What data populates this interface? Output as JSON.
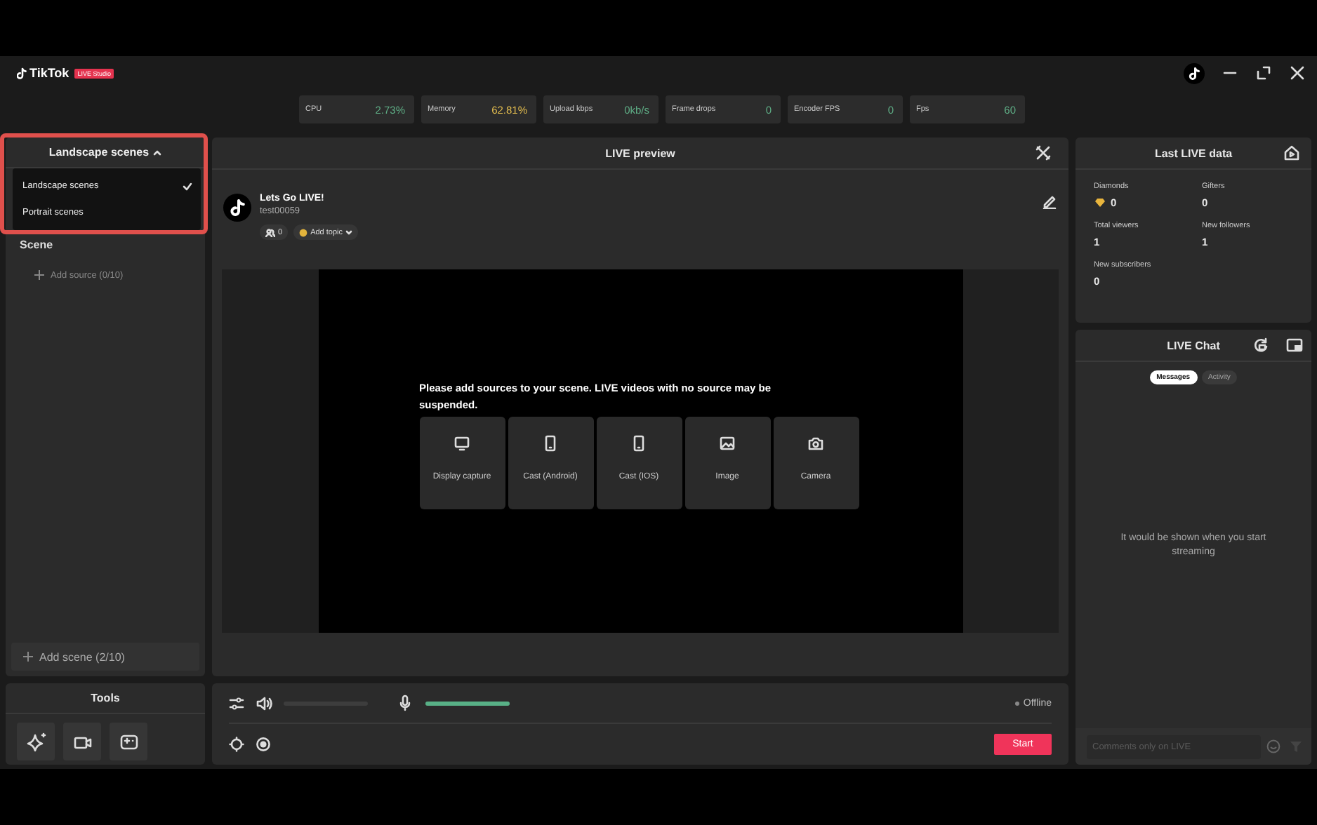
{
  "window": {
    "logo": "TikTok",
    "badge": "LIVE Studio"
  },
  "stats": [
    {
      "label": "CPU",
      "value": "2.73%",
      "color": "#5fae86"
    },
    {
      "label": "Memory",
      "value": "62.81%",
      "color": "#e3bd4f"
    },
    {
      "label": "Upload kbps",
      "value": "0kb/s",
      "color": "#5fae86"
    },
    {
      "label": "Frame drops",
      "value": "0",
      "color": "#5fae86"
    },
    {
      "label": "Encoder FPS",
      "value": "0",
      "color": "#5fae86"
    },
    {
      "label": "Fps",
      "value": "60",
      "color": "#5fae86"
    }
  ],
  "scenes": {
    "title": "Landscape scenes",
    "expanded": true,
    "highlighted": true,
    "options": [
      {
        "label": "Landscape scenes",
        "selected": true
      },
      {
        "label": "Portrait scenes",
        "selected": false
      }
    ],
    "section": "Scene",
    "add_source": "Add source (0/10)",
    "add_scene": "Add scene (2/10)"
  },
  "tools": {
    "title": "Tools"
  },
  "preview": {
    "title": "LIVE preview",
    "stream_title": "Lets Go LIVE!",
    "username": "test00059",
    "viewers": "0",
    "topic": "Add topic",
    "notice": "Please add sources to your scene. LIVE videos with no source may be suspended.",
    "sources": [
      {
        "label": "Display capture",
        "kind": "display"
      },
      {
        "label": "Cast (Android)",
        "kind": "phone"
      },
      {
        "label": "Cast (IOS)",
        "kind": "phone"
      },
      {
        "label": "Image",
        "kind": "image"
      },
      {
        "label": "Camera",
        "kind": "camera"
      }
    ]
  },
  "controls": {
    "speaker": {
      "level": 0
    },
    "mic": {
      "level": 1
    },
    "status": "Offline",
    "start": "Start"
  },
  "last_live": {
    "title": "Last LIVE data",
    "metrics": [
      {
        "label": "Diamonds",
        "value": "0",
        "kind": "diamonds"
      },
      {
        "label": "Gifters",
        "value": "0",
        "kind": "plain"
      },
      {
        "label": "Total viewers",
        "value": "1",
        "kind": "plain"
      },
      {
        "label": "New followers",
        "value": "1",
        "kind": "plain"
      },
      {
        "label": "New subscribers",
        "value": "0",
        "kind": "plain"
      }
    ]
  },
  "chat": {
    "title": "LIVE Chat",
    "tabs": [
      {
        "label": "Messages",
        "selected": true
      },
      {
        "label": "Activity",
        "selected": false
      }
    ],
    "empty": "It would be shown when you start streaming",
    "input": {
      "placeholder": "Comments only on LIVE"
    }
  }
}
